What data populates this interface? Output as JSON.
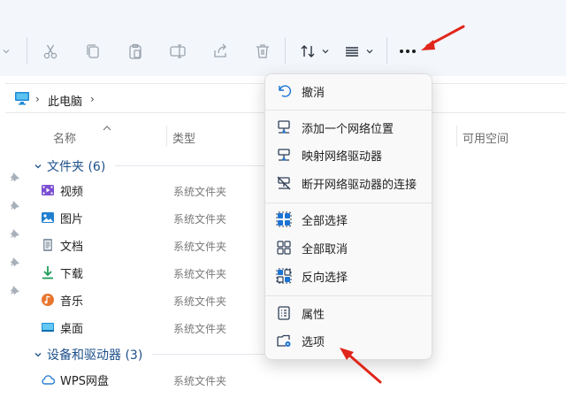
{
  "toolbar": {
    "buttons": [
      "cut-icon",
      "copy-icon",
      "paste-icon",
      "rename-icon",
      "share-icon",
      "delete-icon",
      "sort-icon",
      "view-icon",
      "more-icon"
    ],
    "icon_color": "#9aa3ad"
  },
  "address": {
    "segment": "此电脑",
    "chevron": "›"
  },
  "columns": {
    "name": "名称",
    "type": "类型",
    "free_space": "可用空间"
  },
  "groups": [
    {
      "label": "文件夹 (6)"
    },
    {
      "label": "设备和驱动器 (3)"
    }
  ],
  "rows": [
    {
      "name": "视频",
      "type": "系统文件夹",
      "icon": "video-folder-icon"
    },
    {
      "name": "图片",
      "type": "系统文件夹",
      "icon": "pictures-folder-icon"
    },
    {
      "name": "文档",
      "type": "系统文件夹",
      "icon": "documents-folder-icon"
    },
    {
      "name": "下载",
      "type": "系统文件夹",
      "icon": "downloads-folder-icon"
    },
    {
      "name": "音乐",
      "type": "系统文件夹",
      "icon": "music-folder-icon"
    },
    {
      "name": "桌面",
      "type": "系统文件夹",
      "icon": "desktop-folder-icon"
    },
    {
      "name": "WPS网盘",
      "type": "系统文件夹",
      "icon": "cloud-icon"
    }
  ],
  "menu": {
    "items": [
      {
        "label": "撤消",
        "icon": "undo-icon"
      },
      {
        "label": "添加一个网络位置",
        "icon": "add-network-location-icon"
      },
      {
        "label": "映射网络驱动器",
        "icon": "map-network-drive-icon"
      },
      {
        "label": "断开网络驱动器的连接",
        "icon": "disconnect-network-drive-icon"
      },
      {
        "label": "全部选择",
        "icon": "select-all-icon"
      },
      {
        "label": "全部取消",
        "icon": "select-none-icon"
      },
      {
        "label": "反向选择",
        "icon": "invert-selection-icon"
      },
      {
        "label": "属性",
        "icon": "properties-icon"
      },
      {
        "label": "选项",
        "icon": "options-icon"
      }
    ]
  },
  "colors": {
    "accent": "#1b73d3",
    "group_header": "#1b4f8a",
    "annotation_arrow": "#e0261b"
  }
}
